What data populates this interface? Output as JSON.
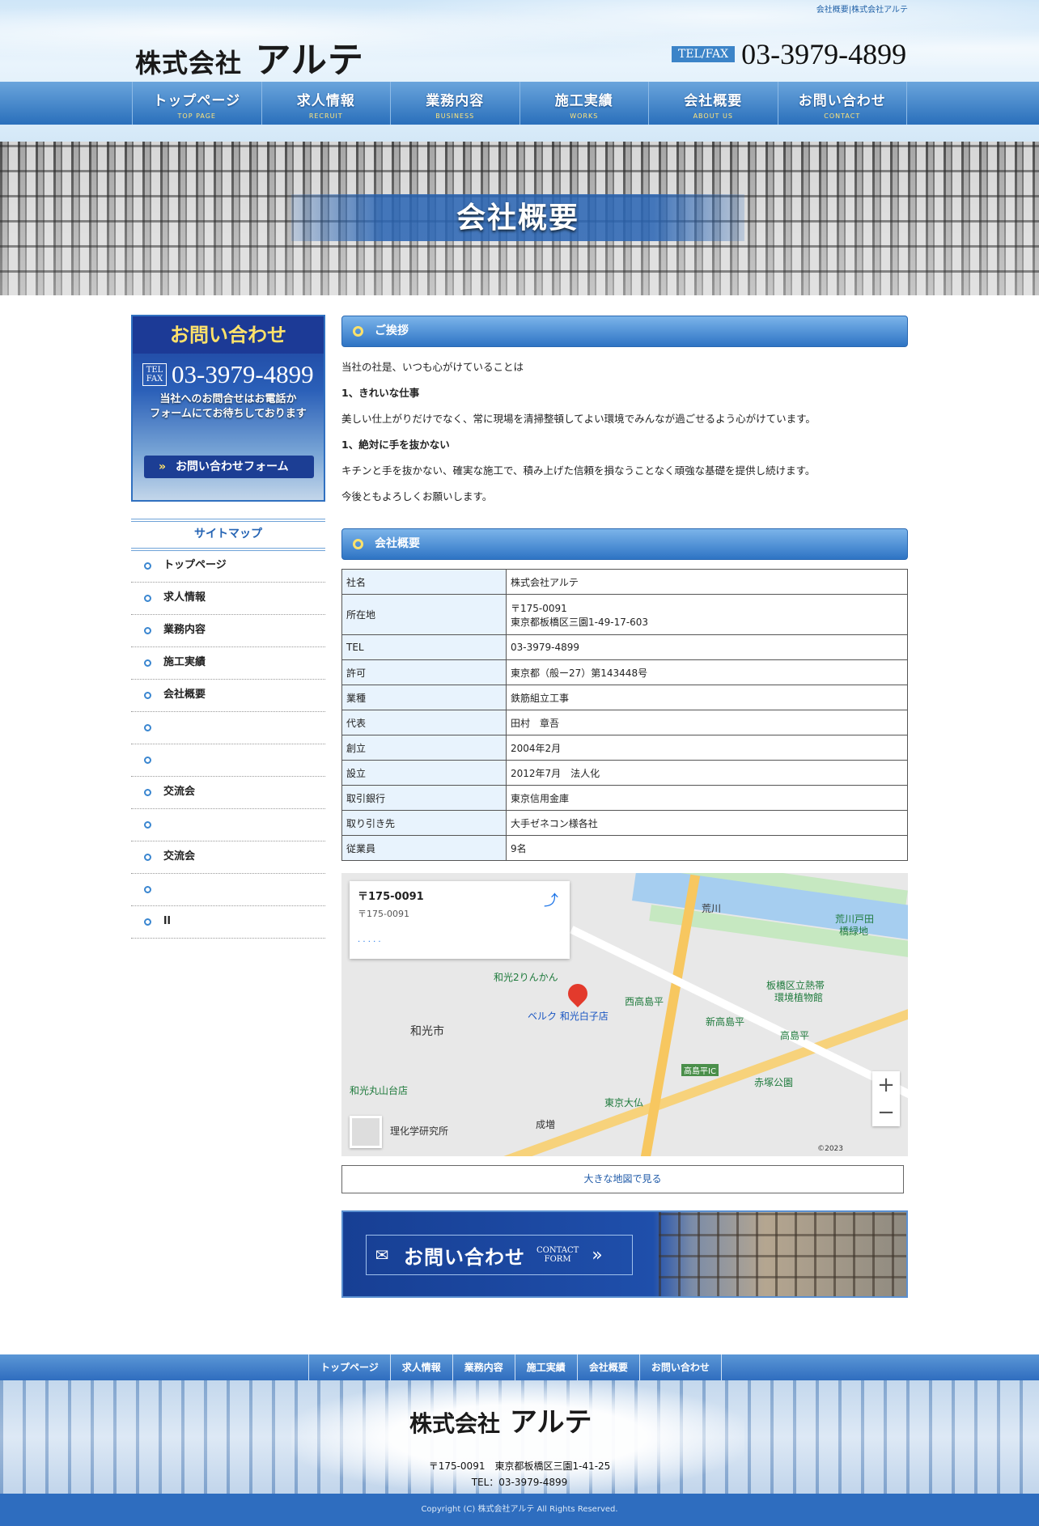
{
  "header": {
    "toplinks": "会社概要|株式会社アルテ",
    "logo_prefix": "株式会社",
    "logo_main": "アルテ",
    "tel_badge": "TEL/FAX",
    "tel_number": "03-3979-4899"
  },
  "nav": [
    {
      "jp": "トップページ",
      "en": "TOP PAGE"
    },
    {
      "jp": "求人情報",
      "en": "RECRUIT"
    },
    {
      "jp": "業務内容",
      "en": "BUSINESS"
    },
    {
      "jp": "施工実績",
      "en": "WORKS"
    },
    {
      "jp": "会社概要",
      "en": "ABOUT US"
    },
    {
      "jp": "お問い合わせ",
      "en": "CONTACT"
    }
  ],
  "hero": {
    "title": "会社概要"
  },
  "sidebar": {
    "contact_title": "お問い合わせ",
    "tel_badge_1": "TEL",
    "tel_badge_2": "FAX",
    "tel_number": "03-3979-4899",
    "msg_1": "当社へのお問合せはお電話か",
    "msg_2": "フォームにてお待ちしております",
    "form_button": "お問い合わせフォーム",
    "sitemap_title": "サイトマップ",
    "sitemap": [
      "トップページ",
      "求人情報",
      "業務内容",
      "施工実績",
      "会社概要",
      "",
      "",
      "交流会",
      "",
      "交流会",
      "",
      "ll"
    ]
  },
  "greeting": {
    "heading": "ご挨拶",
    "p1": "当社の社是、いつも心がけていることは",
    "h1": "1、きれいな仕事",
    "p2": "美しい仕上がりだけでなく、常に現場を清掃整頓してよい環境でみんなが過ごせるよう心がけています。",
    "h2": "1、絶対に手を抜かない",
    "p3": "キチンと手を抜かない、確実な施工で、積み上げた信頼を損なうことなく頑強な基礎を提供し続けます。",
    "p4": "今後ともよろしくお願いします。"
  },
  "company": {
    "heading": "会社概要",
    "rows": [
      {
        "k": "社名",
        "v": "株式会社アルテ"
      },
      {
        "k": "所在地",
        "v": "〒175-0091",
        "v2": "東京都板橋区三園1-49-17-603"
      },
      {
        "k": "TEL",
        "v": "03-3979-4899"
      },
      {
        "k": "許可",
        "v": "東京都（般ー27）第143448号"
      },
      {
        "k": "業種",
        "v": "鉄筋組立工事"
      },
      {
        "k": "代表",
        "v": "田村　章吾"
      },
      {
        "k": "創立",
        "v": "2004年2月"
      },
      {
        "k": "設立",
        "v": "2012年7月　法人化"
      },
      {
        "k": "取引銀行",
        "v": "東京信用金庫"
      },
      {
        "k": "取り引き先",
        "v": "大手ゼネコン様各社"
      },
      {
        "k": "従業員",
        "v": "9名"
      }
    ]
  },
  "map": {
    "card_title": "〒175-0091",
    "card_sub": "〒175-0091",
    "labels": [
      "荒川",
      "荒川戸田",
      "橋緑地",
      "和光2りんかん",
      "板橋区立熱帯",
      "環境植物館",
      "西高島平",
      "新高島平",
      "高島平",
      "和光市",
      "ベルク 和光白子店",
      "赤塚公園",
      "東京大仏",
      "成増",
      "和光丸山台店",
      "理化学研究所",
      "高島平IC"
    ],
    "attribution": "©2023",
    "zoom_in": "+",
    "zoom_out": "−"
  },
  "map_large_link": "大きな地図で見る",
  "contact_banner": {
    "jp": "お問い合わせ",
    "en_1": "CONTACT",
    "en_2": "FORM"
  },
  "footer": {
    "nav": [
      "トップページ",
      "求人情報",
      "業務内容",
      "施工実績",
      "会社概要",
      "お問い合わせ"
    ],
    "logo_prefix": "株式会社",
    "logo_main": "アルテ",
    "address": "〒175-0091　東京都板橋区三園1-41-25",
    "tel": "TEL：03-3979-4899",
    "copyright": "Copyright (C) 株式会社アルテ All Rights Reserved."
  }
}
